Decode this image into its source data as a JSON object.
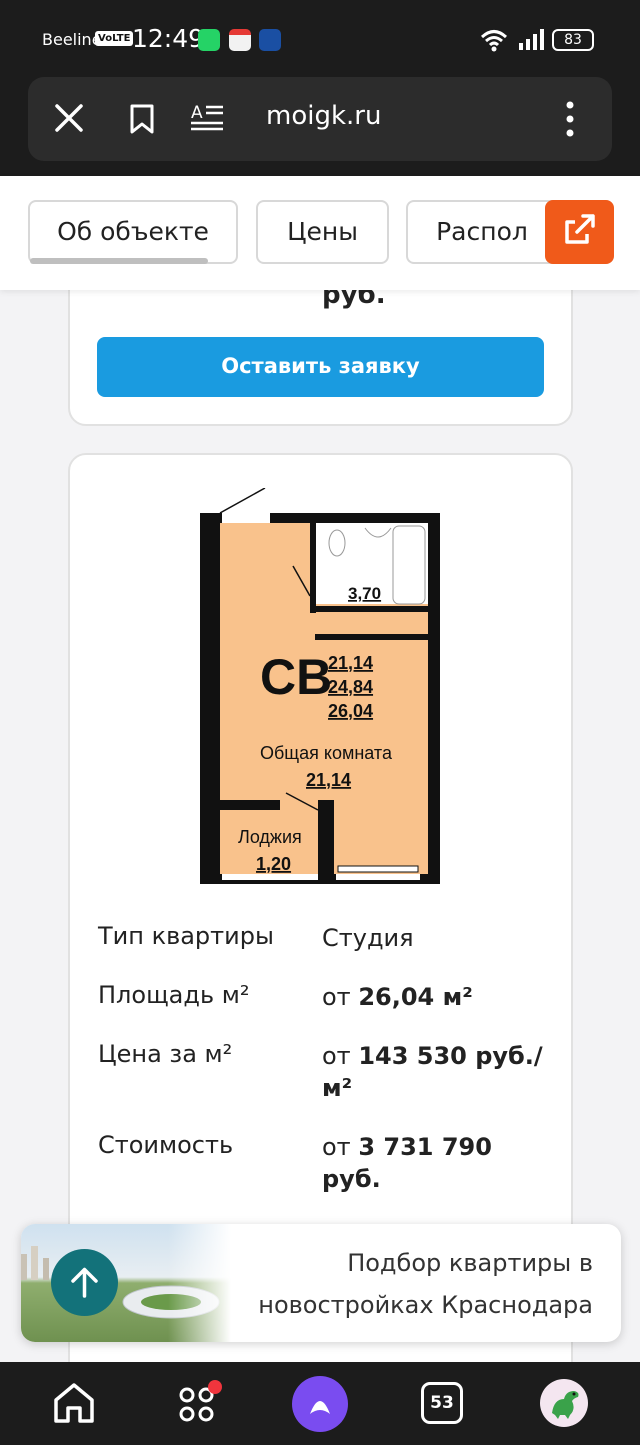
{
  "status_bar": {
    "carrier": "Beeline",
    "volte": "VoLTE",
    "time": "12:49",
    "battery": "83"
  },
  "browser": {
    "url": "moigk.ru"
  },
  "tabs": [
    {
      "label": "Об объекте"
    },
    {
      "label": "Цены"
    },
    {
      "label": "Распол"
    }
  ],
  "prev_card": {
    "price_tail": "руб.",
    "cta_label": "Оставить заявку"
  },
  "plan": {
    "code": "СВ",
    "areas": [
      "21,14",
      "24,84",
      "26,04"
    ],
    "bathroom_area": "3,70",
    "room_label": "Общая комната",
    "room_area": "21,14",
    "loggia_label": "Лоджия",
    "loggia_area": "1,20"
  },
  "specs": {
    "type_label": "Тип квартиры",
    "type_value": "Студия",
    "area_label": "Площадь м²",
    "area_prefix": "от",
    "area_value": "26,04 м²",
    "ppm_label": "Цена за м²",
    "ppm_prefix": "от",
    "ppm_value_line1": "143 530 руб./",
    "ppm_value_line2": "м²",
    "cost_label": "Стоимость",
    "cost_prefix": "от",
    "cost_value_line1": "3 731 790",
    "cost_value_line2": "руб."
  },
  "promo": {
    "text": "Подбор квартиры в новостройках Краснодара"
  },
  "nav": {
    "tabs_count": "53"
  },
  "colors": {
    "accent_orange": "#f05a1a",
    "cta_blue": "#1a9be0",
    "teal": "#13727a",
    "plan_fill": "#f9c28c"
  }
}
